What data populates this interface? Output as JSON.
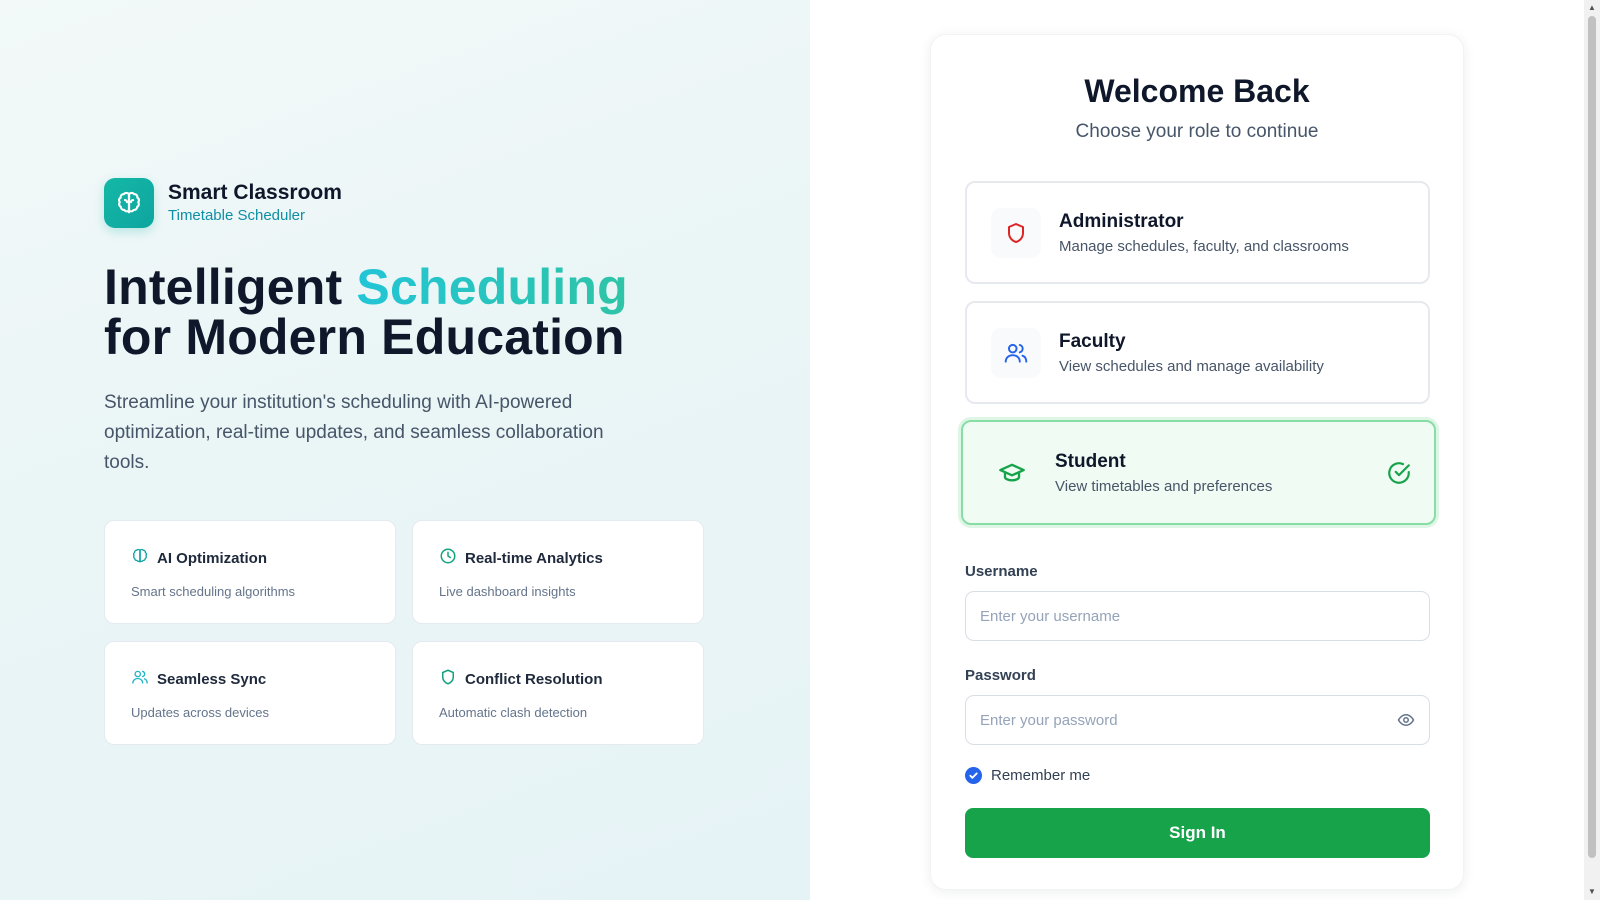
{
  "brand": {
    "name": "Smart Classroom",
    "subtitle": "Timetable Scheduler",
    "logo_icon": "brain-icon"
  },
  "hero": {
    "title_part1": "Intelligent",
    "title_accent": "Scheduling",
    "title_line2": "for Modern Education",
    "description": "Streamline your institution's scheduling with AI-powered optimization, real-time updates, and seamless collaboration tools."
  },
  "features": [
    {
      "title": "AI Optimization",
      "desc": "Smart scheduling algorithms",
      "icon": "brain-icon"
    },
    {
      "title": "Real-time Analytics",
      "desc": "Live dashboard insights",
      "icon": "clock-icon"
    },
    {
      "title": "Seamless Sync",
      "desc": "Updates across devices",
      "icon": "users-icon"
    },
    {
      "title": "Conflict Resolution",
      "desc": "Automatic clash detection",
      "icon": "shield-icon"
    }
  ],
  "login": {
    "title": "Welcome Back",
    "subtitle": "Choose your role to continue",
    "roles": [
      {
        "title": "Administrator",
        "desc": "Manage schedules, faculty, and classrooms",
        "icon": "shield-icon",
        "selected": false
      },
      {
        "title": "Faculty",
        "desc": "View schedules and manage availability",
        "icon": "users-icon",
        "selected": false
      },
      {
        "title": "Student",
        "desc": "View timetables and preferences",
        "icon": "graduation-cap-icon",
        "selected": true
      }
    ],
    "username_label": "Username",
    "username_placeholder": "Enter your username",
    "username_value": "",
    "password_label": "Password",
    "password_placeholder": "Enter your password",
    "password_value": "",
    "remember_label": "Remember me",
    "remember_checked": true,
    "signin_label": "Sign In"
  },
  "colors": {
    "brand_teal": "#14b8a6",
    "accent_blue": "#0e8fa3",
    "selected_green": "#16a34a",
    "admin_red": "#dc2626",
    "faculty_blue": "#2563eb"
  }
}
